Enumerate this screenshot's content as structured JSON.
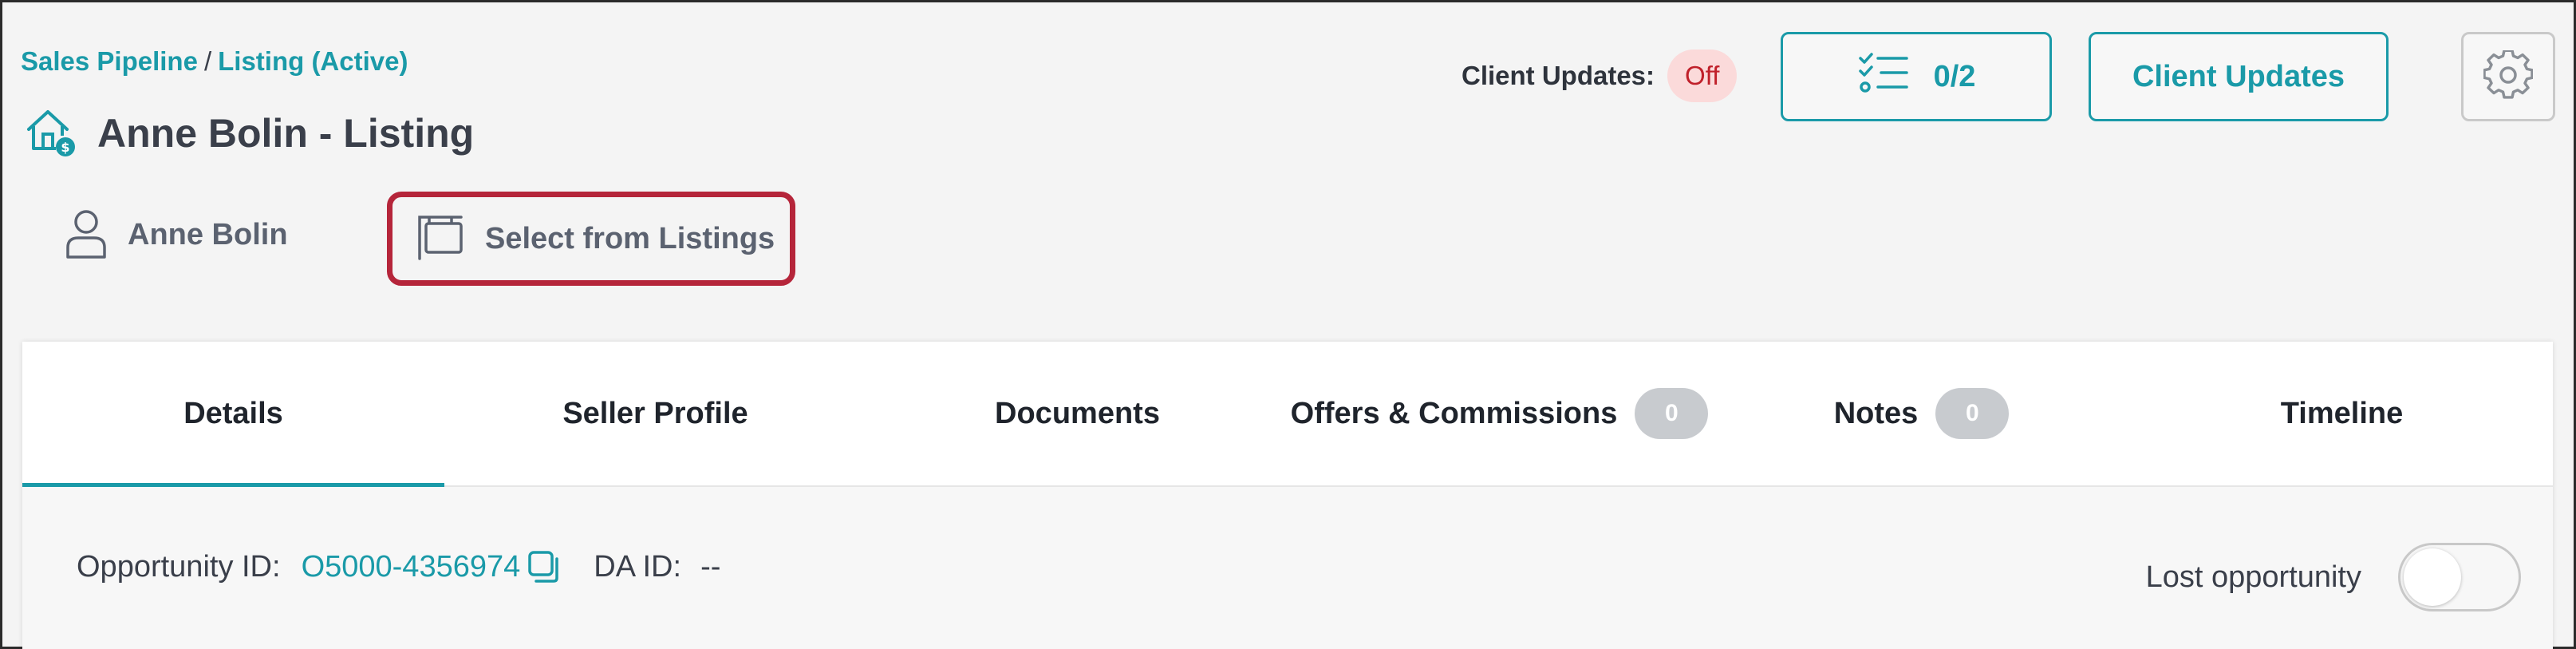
{
  "breadcrumb": {
    "part1": "Sales Pipeline",
    "separator": "/",
    "part2": "Listing (Active)"
  },
  "page": {
    "title": "Anne Bolin - Listing"
  },
  "contact": {
    "name": "Anne Bolin"
  },
  "listing_select": {
    "label": "Select from Listings"
  },
  "client_updates_status": {
    "label": "Client Updates:",
    "value": "Off"
  },
  "toolbar": {
    "tasks_count": "0/2",
    "client_updates_label": "Client Updates"
  },
  "tabs": [
    {
      "label": "Details",
      "active": true
    },
    {
      "label": "Seller Profile"
    },
    {
      "label": "Documents"
    },
    {
      "label": "Offers & Commissions",
      "badge": "0"
    },
    {
      "label": "Notes",
      "badge": "0"
    },
    {
      "label": "Timeline"
    }
  ],
  "details": {
    "opportunity_label": "Opportunity ID:",
    "opportunity_value": "O5000-4356974",
    "da_label": "DA ID:",
    "da_value": "--",
    "lost_label": "Lost opportunity"
  },
  "colors": {
    "accent": "#1a9aa8",
    "highlight": "#b5253a",
    "off_bg": "#fbdada",
    "off_text": "#c0202a"
  },
  "icons": [
    "house-dollar-icon",
    "person-icon",
    "listing-sign-icon",
    "checklist-icon",
    "gear-icon",
    "copy-icon"
  ]
}
